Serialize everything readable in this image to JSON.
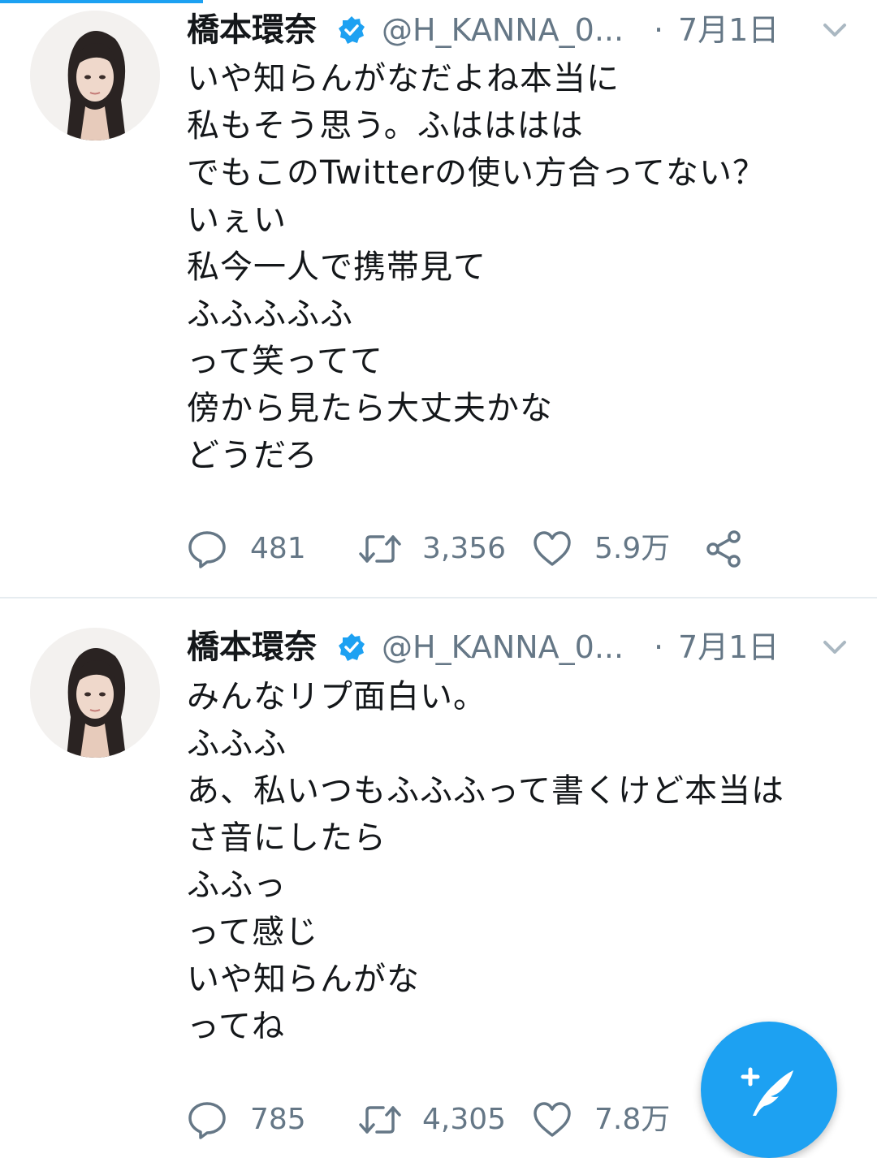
{
  "colors": {
    "accent": "#1da1f2",
    "secondary_text": "#657786",
    "primary_text": "#14171a",
    "divider": "#e6ecf0"
  },
  "tweets": [
    {
      "author_name": "橋本環奈",
      "handle": "@H_KANNA_0...",
      "separator": "·",
      "date": "7月1日",
      "lines": [
        "いや知らんがなだよね本当に",
        "私もそう思う。ふはははは",
        "でもこのTwitterの使い方合ってない？",
        "いぇい",
        "私今一人で携帯見て",
        "ふふふふふ",
        "って笑ってて",
        "傍から見たら大丈夫かな",
        "どうだろ"
      ],
      "replies": "481",
      "retweets": "3,356",
      "likes": "5.9万"
    },
    {
      "author_name": "橋本環奈",
      "handle": "@H_KANNA_0...",
      "separator": "·",
      "date": "7月1日",
      "lines": [
        "みんなリプ面白い。",
        "ふふふ",
        "あ、私いつもふふふって書くけど本当は",
        "さ音にしたら",
        "ふふっ",
        "って感じ",
        "いや知らんがな",
        "ってね"
      ],
      "replies": "785",
      "retweets": "4,305",
      "likes": "7.8万"
    }
  ],
  "icons": {
    "verified": "verified-badge-icon",
    "caret": "chevron-down-icon",
    "reply": "reply-icon",
    "retweet": "retweet-icon",
    "like": "heart-icon",
    "share": "share-icon",
    "compose": "compose-tweet-icon"
  }
}
